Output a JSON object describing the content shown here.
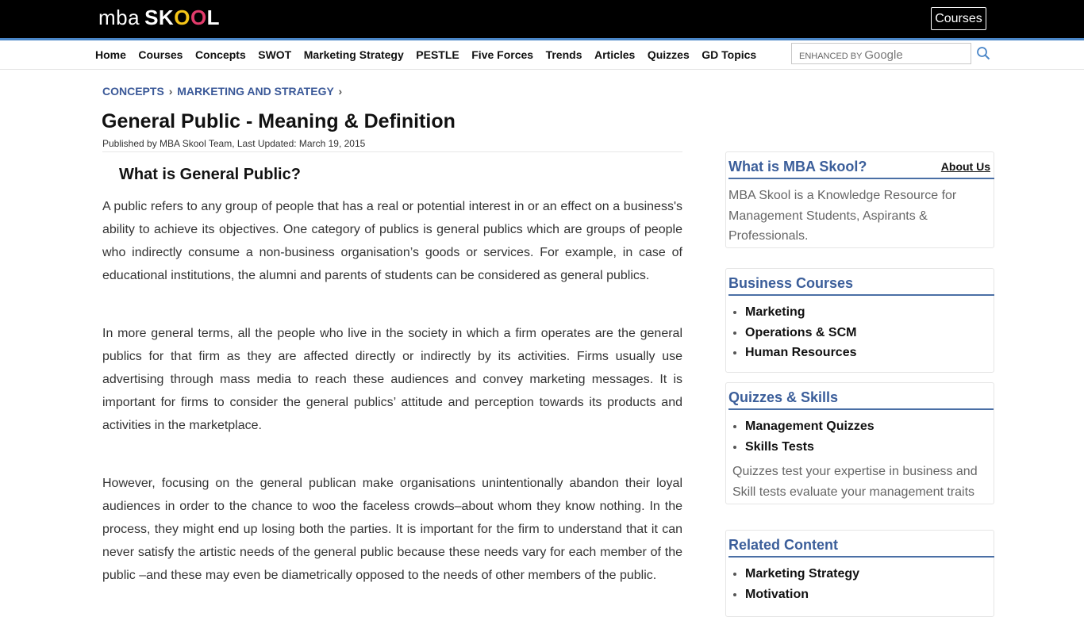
{
  "header": {
    "logo_mba": "mba",
    "logo_skool": "SKOOL",
    "courses_button": "Courses"
  },
  "nav": {
    "items": [
      "Home",
      "Courses",
      "Concepts",
      "SWOT",
      "Marketing Strategy",
      "PESTLE",
      "Five Forces",
      "Trends",
      "Articles",
      "Quizzes",
      "GD Topics"
    ]
  },
  "search": {
    "brand_label": "ENHANCED BY",
    "brand_name": "Google",
    "value": ""
  },
  "breadcrumb": {
    "items": [
      "CONCEPTS",
      "MARKETING AND STRATEGY"
    ],
    "separator": "›"
  },
  "article": {
    "title": "General Public - Meaning & Definition",
    "meta": "Published by MBA Skool Team, Last Updated: March 19, 2015",
    "heading": "What is General Public?",
    "paragraphs": [
      "A public refers to any group of people that has a real or potential interest in or an effect on a business's ability to achieve its objectives. One category of publics is general publics which are groups of people who indirectly consume a non-business organisation’s goods or services. For example, in case of educational institutions, the alumni and parents of students can be considered as general publics.",
      "In more general terms, all the people who live in the society in which a firm operates are the general publics for that firm as they are affected directly or indirectly by its activities. Firms usually use advertising through mass media to reach these audiences and convey marketing messages. It is important for firms to consider the general publics’ attitude and perception towards its products and activities in the marketplace.",
      "However, focusing on the general publican make organisations unintentionally abandon their loyal audiences in order to the chance to woo the faceless crowds–about whom they know nothing. In the process, they might end up losing both the parties. It is important for the firm to understand that it can never satisfy the artistic needs of the general public because these needs vary for each member of the public –and these may even be diametrically opposed to the needs of other members of the public."
    ]
  },
  "sidebar": {
    "about": {
      "title": "What is MBA Skool?",
      "link": "About Us",
      "text": "MBA Skool is a Knowledge Resource for Management Students, Aspirants & Professionals."
    },
    "courses": {
      "title": "Business Courses",
      "items": [
        "Marketing",
        "Operations & SCM",
        "Human Resources"
      ]
    },
    "quizzes": {
      "title": "Quizzes & Skills",
      "items": [
        "Management Quizzes",
        "Skills Tests"
      ],
      "text": "Quizzes test your expertise in business and Skill tests evaluate your management traits"
    },
    "related": {
      "title": "Related Content",
      "items": [
        "Marketing Strategy",
        "Motivation"
      ]
    }
  },
  "colors": {
    "topbar": "#000000",
    "accent_line": "#4a86c8",
    "link_blue": "#3b5998",
    "sidebar_title": "#3b5e9a"
  }
}
